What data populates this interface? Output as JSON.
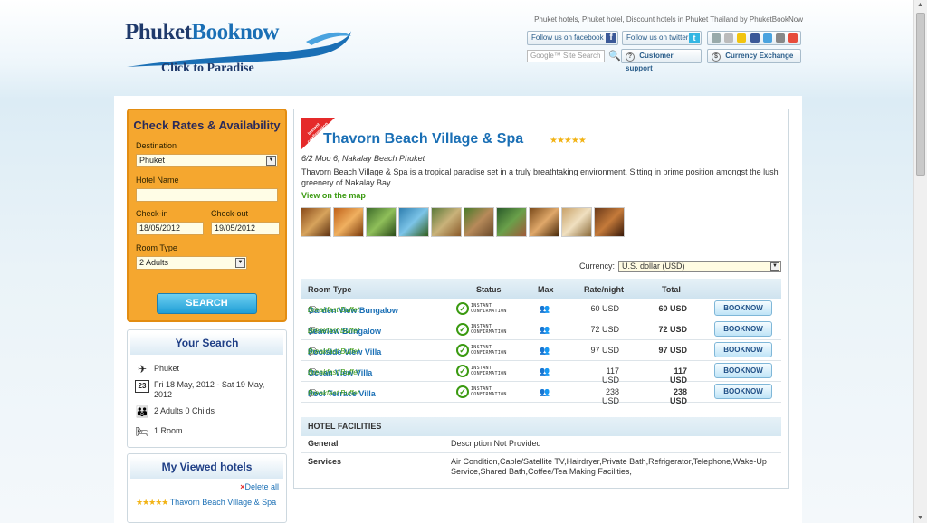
{
  "header": {
    "tagline": "Phuket hotels, Phuket hotel, Discount hotels in Phuket Thailand by PhuketBookNow",
    "logo_part1": "Phuket",
    "logo_part2": "Booknow",
    "logo_tagline": "Click to Paradise",
    "facebook_label": "Follow us on facebook",
    "twitter_label": "Follow us on twitter",
    "search_placeholder": "Site Search",
    "google_label": "Google™",
    "support_label": "Customer support",
    "exchange_label": "Currency Exchange"
  },
  "booking": {
    "title": "Check Rates & Availability",
    "destination_label": "Destination",
    "destination_value": "Phuket",
    "hotel_name_label": "Hotel Name",
    "hotel_name_value": "",
    "checkin_label": "Check-in",
    "checkin_value": "18/05/2012",
    "checkout_label": "Check-out",
    "checkout_value": "19/05/2012",
    "room_type_label": "Room Type",
    "room_type_value": "2 Adults",
    "search_label": "SEARCH"
  },
  "your_search": {
    "title": "Your Search",
    "location": "Phuket",
    "dates": "Fri 18 May, 2012 - Sat 19 May, 2012",
    "guests": "2 Adults 0 Childs",
    "rooms": "1 Room",
    "calendar_day": "23"
  },
  "viewed": {
    "title": "My Viewed hotels",
    "delete_label": "Delete all",
    "hotel": "Thavorn Beach Village & Spa"
  },
  "hotel": {
    "badge": "Instant confirmation",
    "name": "Thavorn Beach Village & Spa",
    "stars": "★★★★★",
    "address": "6/2 Moo 6, Nakalay Beach Phuket",
    "description": "Thavorn Beach Village & Spa is a tropical paradise set in a truly breathtaking environment. Sitting in prime position amongst the lush greenery of Nakalay Bay.",
    "map_link": "View on the map"
  },
  "currency": {
    "label": "Currency:",
    "value": "U.S. dollar (USD)"
  },
  "rooms_table": {
    "headers": {
      "room_type": "Room Type",
      "status": "Status",
      "max": "Max",
      "rate": "Rate/night",
      "total": "Total"
    },
    "status_text": "INSTANT CONFIRMATION",
    "book_label": "BOOKNOW",
    "rows": [
      {
        "name": "Garden View Bungalow",
        "meal": "Breakfast Buffet",
        "rate": "60 USD",
        "total": "60 USD"
      },
      {
        "name": "Seaview Bungalow",
        "meal": "Breakfast Buffet",
        "rate": "72 USD",
        "total": "72 USD"
      },
      {
        "name": "Poolside View Villa",
        "meal": "Breakfast Buffet",
        "rate": "97 USD",
        "total": "97 USD"
      },
      {
        "name": "Ocean View Villa",
        "meal": "Breakfast Buffet",
        "rate": "117 USD",
        "total": "117 USD"
      },
      {
        "name": "Pool Terrace Villa",
        "meal": "Breakfast Buffet",
        "rate": "238 USD",
        "total": "238 USD"
      }
    ]
  },
  "facilities": {
    "title": "HOTEL FACILITIES",
    "general_label": "General",
    "general_value": "Description Not Provided",
    "services_label": "Services",
    "services_value": "Air Condition,Cable/Satellite TV,Hairdryer,Private Bath,Refrigerator,Telephone,Wake-Up Service,Shared Bath,Coffee/Tea Making Facilities,"
  },
  "colors": {
    "brand_blue": "#1a6fb5",
    "booking_orange": "#f5a72f",
    "green_link": "#3b9a11"
  },
  "icons": {
    "scroll_up": "▲",
    "scroll_down": "▼",
    "dropdown": "▼",
    "search_go": "🔍",
    "support_icon": "?",
    "exchange_icon": "$",
    "plane": "✈",
    "guests": "👪",
    "bed": "🛏",
    "delete_x": "×",
    "room_speech": "💬",
    "check": "✓",
    "max_guests": "👥"
  }
}
